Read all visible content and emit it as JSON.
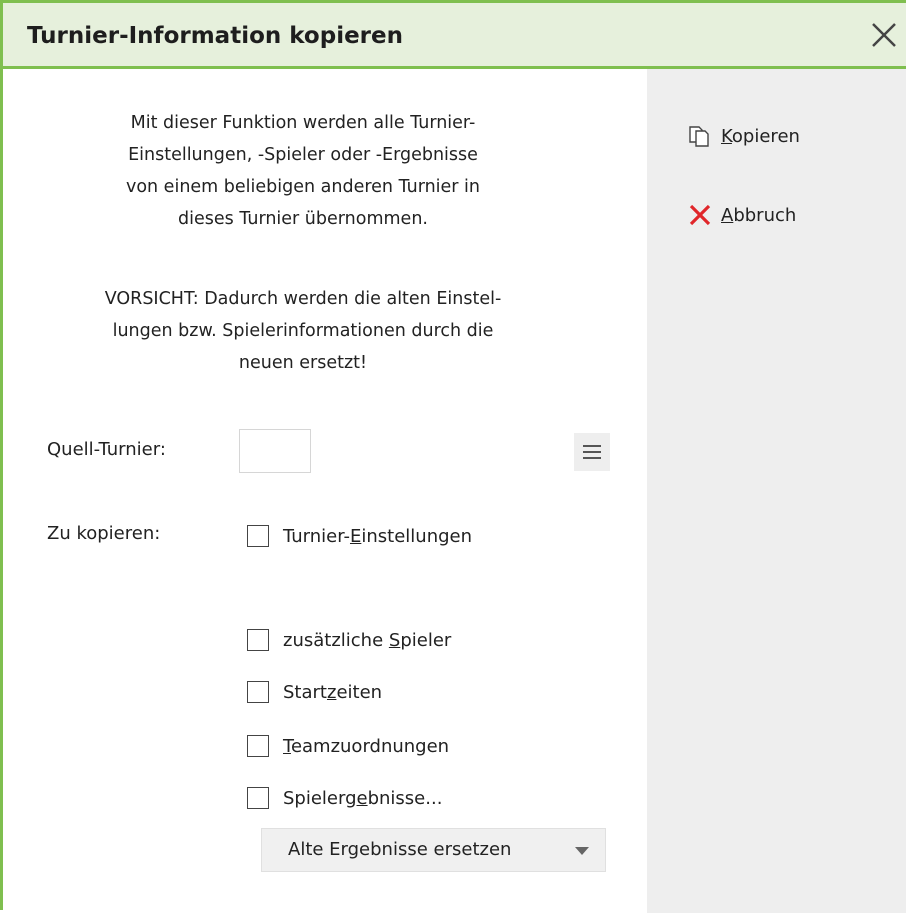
{
  "dialog": {
    "title": "Turnier-Information kopieren",
    "close_icon": "close-icon"
  },
  "sidebar": {
    "copy": {
      "icon": "copy-icon",
      "mnemonic": "K",
      "rest": "opieren"
    },
    "cancel": {
      "icon": "red-x-icon",
      "mnemonic": "A",
      "rest": "bbruch",
      "icon_color": "#e0262a"
    }
  },
  "info": {
    "lines1": [
      "Mit dieser Funktion werden alle Turnier-",
      "Einstellungen, -Spieler oder -Ergebnisse",
      "von einem beliebigen anderen Turnier in",
      "dieses Turnier übernommen."
    ],
    "lines2": [
      "VORSICHT: Dadurch werden die alten Einstel-",
      "lungen bzw. Spielerinformationen durch die",
      "neuen ersetzt!"
    ]
  },
  "form": {
    "source_label": "Quell-Turnier:",
    "source_value": "",
    "copy_label": "Zu kopieren:",
    "options": [
      {
        "pre": "Turnier-",
        "mnemonic": "E",
        "post": "instellungen",
        "checked": false
      },
      {
        "pre": "zusätzliche ",
        "mnemonic": "S",
        "post": "pieler",
        "checked": false
      },
      {
        "pre": "Start",
        "mnemonic": "z",
        "post": "eiten",
        "checked": false
      },
      {
        "pre": "",
        "mnemonic": "T",
        "post": "eamzuordnungen",
        "checked": false
      },
      {
        "pre": "Spielerg",
        "mnemonic": "e",
        "post": "bnisse...",
        "checked": false
      }
    ],
    "results_mode": "Alte Ergebnisse ersetzen"
  },
  "colors": {
    "accent_green": "#7fbf4f",
    "titlebar_bg": "#e6f0dc",
    "sidebar_bg": "#eeeeee",
    "cancel_red": "#e0262a"
  }
}
